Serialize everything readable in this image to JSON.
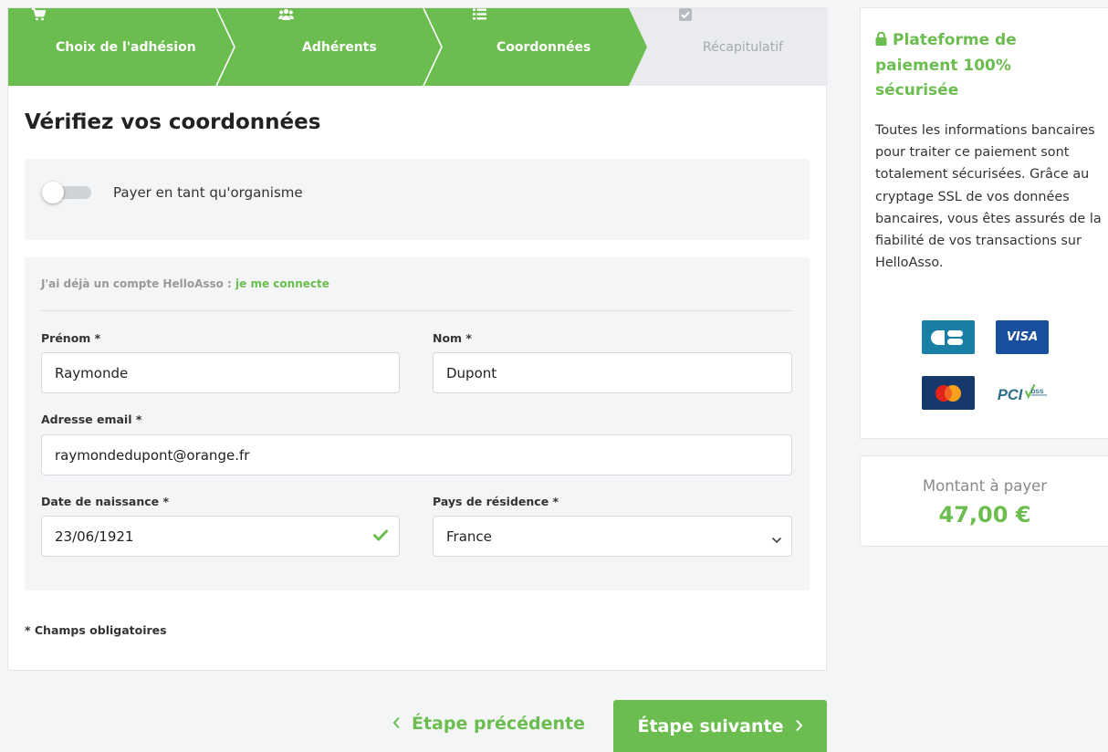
{
  "stepper": {
    "steps": [
      {
        "label": "Choix de l'adhésion",
        "icon": "cart-icon",
        "state": "done"
      },
      {
        "label": "Adhérents",
        "icon": "users-icon",
        "state": "done"
      },
      {
        "label": "Coordonnées",
        "icon": "list-icon",
        "state": "current"
      },
      {
        "label": "Récapitulatif",
        "icon": "checkbox-icon",
        "state": "upcoming"
      }
    ]
  },
  "form": {
    "title": "Vérifiez vos coordonnées",
    "org_toggle_label": "Payer en tant qu'organisme",
    "org_toggle_on": false,
    "account_prefix": "J'ai déjà un compte HelloAsso : ",
    "account_link": "je me connecte",
    "fields": {
      "prenom": {
        "label": "Prénom *",
        "value": "Raymonde"
      },
      "nom": {
        "label": "Nom *",
        "value": "Dupont"
      },
      "email": {
        "label": "Adresse email *",
        "value": "raymondedupont@orange.fr"
      },
      "naissance": {
        "label": "Date de naissance *",
        "value": "23/06/1921"
      },
      "pays": {
        "label": "Pays de résidence *",
        "value": "France"
      }
    },
    "required_note": "* Champs obligatoires"
  },
  "nav": {
    "prev_label": "Étape précédente",
    "next_label": "Étape suivante"
  },
  "security": {
    "title": "Plateforme de paiement 100% sécurisée",
    "body": "Toutes les informations bancaires pour traiter ce paiement sont totalement sécurisées. Grâce au cryptage SSL de vos données bancaires, vous êtes assurés de la fiabilité de vos transactions sur HelloAsso.",
    "cards": [
      "CB",
      "VISA",
      "MasterCard",
      "PCI DSS"
    ]
  },
  "amount": {
    "label": "Montant à payer",
    "value": "47,00 €"
  },
  "colors": {
    "accent": "#6bbd4f",
    "inactive_step_bg": "#e9ebee"
  }
}
